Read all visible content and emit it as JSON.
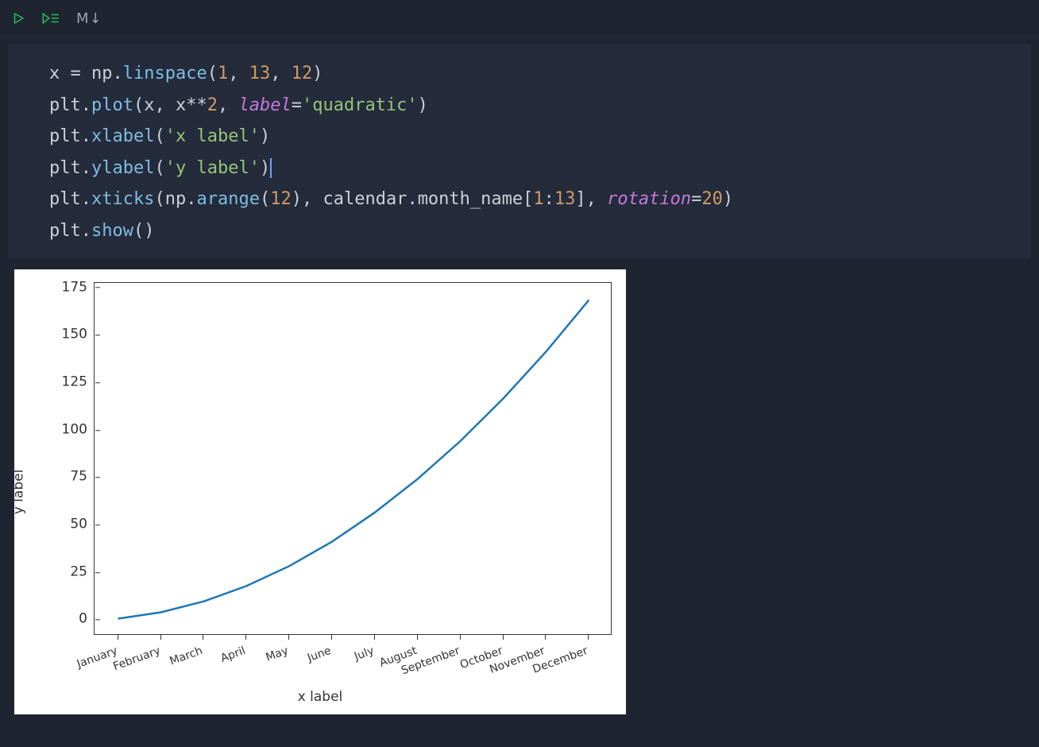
{
  "toolbar": {
    "md_label": "M↓"
  },
  "code": {
    "lines": [
      {
        "segments": [
          {
            "t": "x ",
            "c": "c-var"
          },
          {
            "t": "= ",
            "c": "c-op"
          },
          {
            "t": "np",
            "c": "c-pkg"
          },
          {
            "t": ".",
            "c": "c-dot"
          },
          {
            "t": "linspace",
            "c": "c-fun"
          },
          {
            "t": "(",
            "c": "c-paren"
          },
          {
            "t": "1",
            "c": "c-num"
          },
          {
            "t": ", ",
            "c": "c-op"
          },
          {
            "t": "13",
            "c": "c-num"
          },
          {
            "t": ", ",
            "c": "c-op"
          },
          {
            "t": "12",
            "c": "c-num"
          },
          {
            "t": ")",
            "c": "c-paren"
          }
        ]
      },
      {
        "segments": [
          {
            "t": "plt",
            "c": "c-pkg"
          },
          {
            "t": ".",
            "c": "c-dot"
          },
          {
            "t": "plot",
            "c": "c-fun"
          },
          {
            "t": "(",
            "c": "c-paren"
          },
          {
            "t": "x",
            "c": "c-var"
          },
          {
            "t": ", ",
            "c": "c-op"
          },
          {
            "t": "x",
            "c": "c-var"
          },
          {
            "t": "**",
            "c": "c-op"
          },
          {
            "t": "2",
            "c": "c-num"
          },
          {
            "t": ", ",
            "c": "c-op"
          },
          {
            "t": "label",
            "c": "c-kw"
          },
          {
            "t": "=",
            "c": "c-op"
          },
          {
            "t": "'quadratic'",
            "c": "c-str"
          },
          {
            "t": ")",
            "c": "c-paren"
          }
        ]
      },
      {
        "segments": [
          {
            "t": "plt",
            "c": "c-pkg"
          },
          {
            "t": ".",
            "c": "c-dot"
          },
          {
            "t": "xlabel",
            "c": "c-fun"
          },
          {
            "t": "(",
            "c": "c-paren"
          },
          {
            "t": "'x label'",
            "c": "c-str"
          },
          {
            "t": ")",
            "c": "c-paren"
          }
        ]
      },
      {
        "segments": [
          {
            "t": "plt",
            "c": "c-pkg"
          },
          {
            "t": ".",
            "c": "c-dot"
          },
          {
            "t": "ylabel",
            "c": "c-fun"
          },
          {
            "t": "(",
            "c": "c-paren"
          },
          {
            "t": "'y label'",
            "c": "c-str"
          },
          {
            "t": ")",
            "c": "c-paren",
            "cursor": true
          }
        ]
      },
      {
        "segments": [
          {
            "t": "plt",
            "c": "c-pkg"
          },
          {
            "t": ".",
            "c": "c-dot"
          },
          {
            "t": "xticks",
            "c": "c-fun"
          },
          {
            "t": "(",
            "c": "c-paren"
          },
          {
            "t": "np",
            "c": "c-pkg"
          },
          {
            "t": ".",
            "c": "c-dot"
          },
          {
            "t": "arange",
            "c": "c-fun"
          },
          {
            "t": "(",
            "c": "c-paren"
          },
          {
            "t": "12",
            "c": "c-num"
          },
          {
            "t": ")",
            "c": "c-paren"
          },
          {
            "t": ", ",
            "c": "c-op"
          },
          {
            "t": "calendar",
            "c": "c-pkg"
          },
          {
            "t": ".",
            "c": "c-dot"
          },
          {
            "t": "month_name",
            "c": "c-var"
          },
          {
            "t": "[",
            "c": "c-paren"
          },
          {
            "t": "1",
            "c": "c-num"
          },
          {
            "t": ":",
            "c": "c-sli"
          },
          {
            "t": "13",
            "c": "c-num"
          },
          {
            "t": "]",
            "c": "c-paren"
          },
          {
            "t": ", ",
            "c": "c-op"
          },
          {
            "t": "rotation",
            "c": "c-kw"
          },
          {
            "t": "=",
            "c": "c-op"
          },
          {
            "t": "20",
            "c": "c-num"
          },
          {
            "t": ")",
            "c": "c-paren"
          }
        ]
      },
      {
        "segments": [
          {
            "t": "plt",
            "c": "c-pkg"
          },
          {
            "t": ".",
            "c": "c-dot"
          },
          {
            "t": "show",
            "c": "c-fun"
          },
          {
            "t": "()",
            "c": "c-paren"
          }
        ]
      }
    ]
  },
  "chart_data": {
    "type": "line",
    "series": [
      {
        "name": "quadratic",
        "x": [
          1,
          2.09,
          3.18,
          4.27,
          5.36,
          6.45,
          7.55,
          8.64,
          9.73,
          10.82,
          11.91,
          13
        ],
        "y": [
          1,
          4.37,
          10.11,
          18.23,
          28.73,
          41.61,
          57,
          74.66,
          94.68,
          117.07,
          141.79,
          169
        ]
      }
    ],
    "categories": [
      "January",
      "February",
      "March",
      "April",
      "May",
      "June",
      "July",
      "August",
      "September",
      "October",
      "November",
      "December"
    ],
    "title": "",
    "xlabel": "x label",
    "ylabel": "y label",
    "y_ticks": [
      0,
      25,
      50,
      75,
      100,
      125,
      150,
      175
    ],
    "ylim": [
      -8,
      178
    ],
    "xlim_index": [
      -0.55,
      11.55
    ],
    "line_color": "#1f77b4"
  }
}
